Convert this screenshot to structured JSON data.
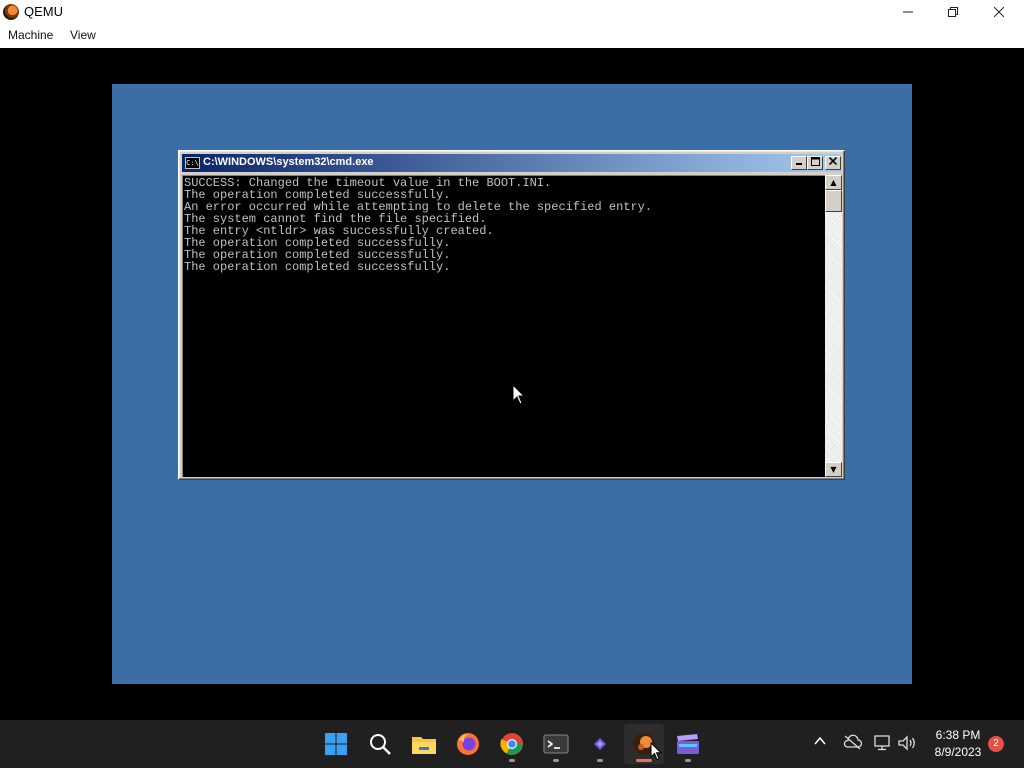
{
  "host_window": {
    "title": "QEMU",
    "menu": [
      "Machine",
      "View"
    ],
    "controls": [
      "minimize",
      "restore",
      "close"
    ]
  },
  "cmd_window": {
    "title": "C:\\WINDOWS\\system32\\cmd.exe",
    "icon_text": "C:\\",
    "lines": [
      "SUCCESS: Changed the timeout value in the BOOT.INI.",
      "The operation completed successfully.",
      "An error occurred while attempting to delete the specified entry.",
      "The system cannot find the file specified.",
      "The entry <ntldr> was successfully created.",
      "The operation completed successfully.",
      "The operation completed successfully.",
      "The operation completed successfully."
    ]
  },
  "taskbar": {
    "apps": [
      {
        "name": "start",
        "icon": "windows-start-icon"
      },
      {
        "name": "search",
        "icon": "search-icon"
      },
      {
        "name": "file-explorer",
        "icon": "folder-icon"
      },
      {
        "name": "firefox",
        "icon": "firefox-icon"
      },
      {
        "name": "chrome",
        "icon": "chrome-icon"
      },
      {
        "name": "terminal",
        "icon": "terminal-icon"
      },
      {
        "name": "visual-studio",
        "icon": "vs-icon"
      },
      {
        "name": "qemu",
        "icon": "qemu-icon",
        "active": true
      },
      {
        "name": "clapper",
        "icon": "clapper-icon"
      }
    ],
    "tray": {
      "icons": [
        "chevron-up-icon",
        "cloud-off-icon",
        "network-icon",
        "volume-icon"
      ],
      "time": "6:38 PM",
      "date": "8/9/2023",
      "notification_count": "2"
    }
  },
  "colors": {
    "guest_desktop": "#3a6ea5",
    "cmd_title_start": "#0a246a",
    "cmd_title_end": "#a6caf0",
    "console_text": "#c0c0c0",
    "taskbar_bg": "#202020",
    "badge": "#e5504a"
  }
}
